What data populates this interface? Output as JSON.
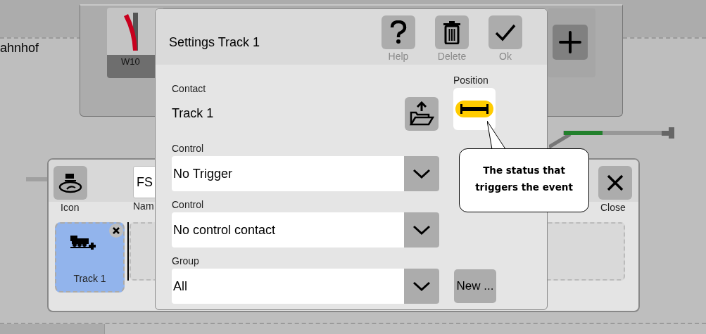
{
  "background": {
    "station_label": "ahnhof"
  },
  "top_panel": {
    "tiles": [
      {
        "label": "W10"
      }
    ]
  },
  "editor_panel": {
    "icon_button": {
      "label": "Icon"
    },
    "name_field": {
      "value": "FS",
      "label": "Nam"
    },
    "close_button": {
      "label": "Close"
    },
    "items": [
      {
        "label": "Track 1",
        "selected": true
      }
    ]
  },
  "dialog": {
    "title": "Settings Track 1",
    "toolbar": [
      {
        "label": "Help",
        "kind": "help"
      },
      {
        "label": "Delete",
        "kind": "delete"
      },
      {
        "label": "Ok",
        "kind": "ok"
      }
    ],
    "contact": {
      "label": "Contact",
      "value": "Track 1"
    },
    "position": {
      "label": "Position"
    },
    "selects": [
      {
        "label": "Control",
        "value": "No Trigger"
      },
      {
        "label": "Control",
        "value": "No control contact"
      },
      {
        "label": "Group",
        "value": "All",
        "new_button": "New ..."
      }
    ]
  },
  "tooltip": {
    "lines": [
      "The status that",
      "triggers the event"
    ]
  }
}
